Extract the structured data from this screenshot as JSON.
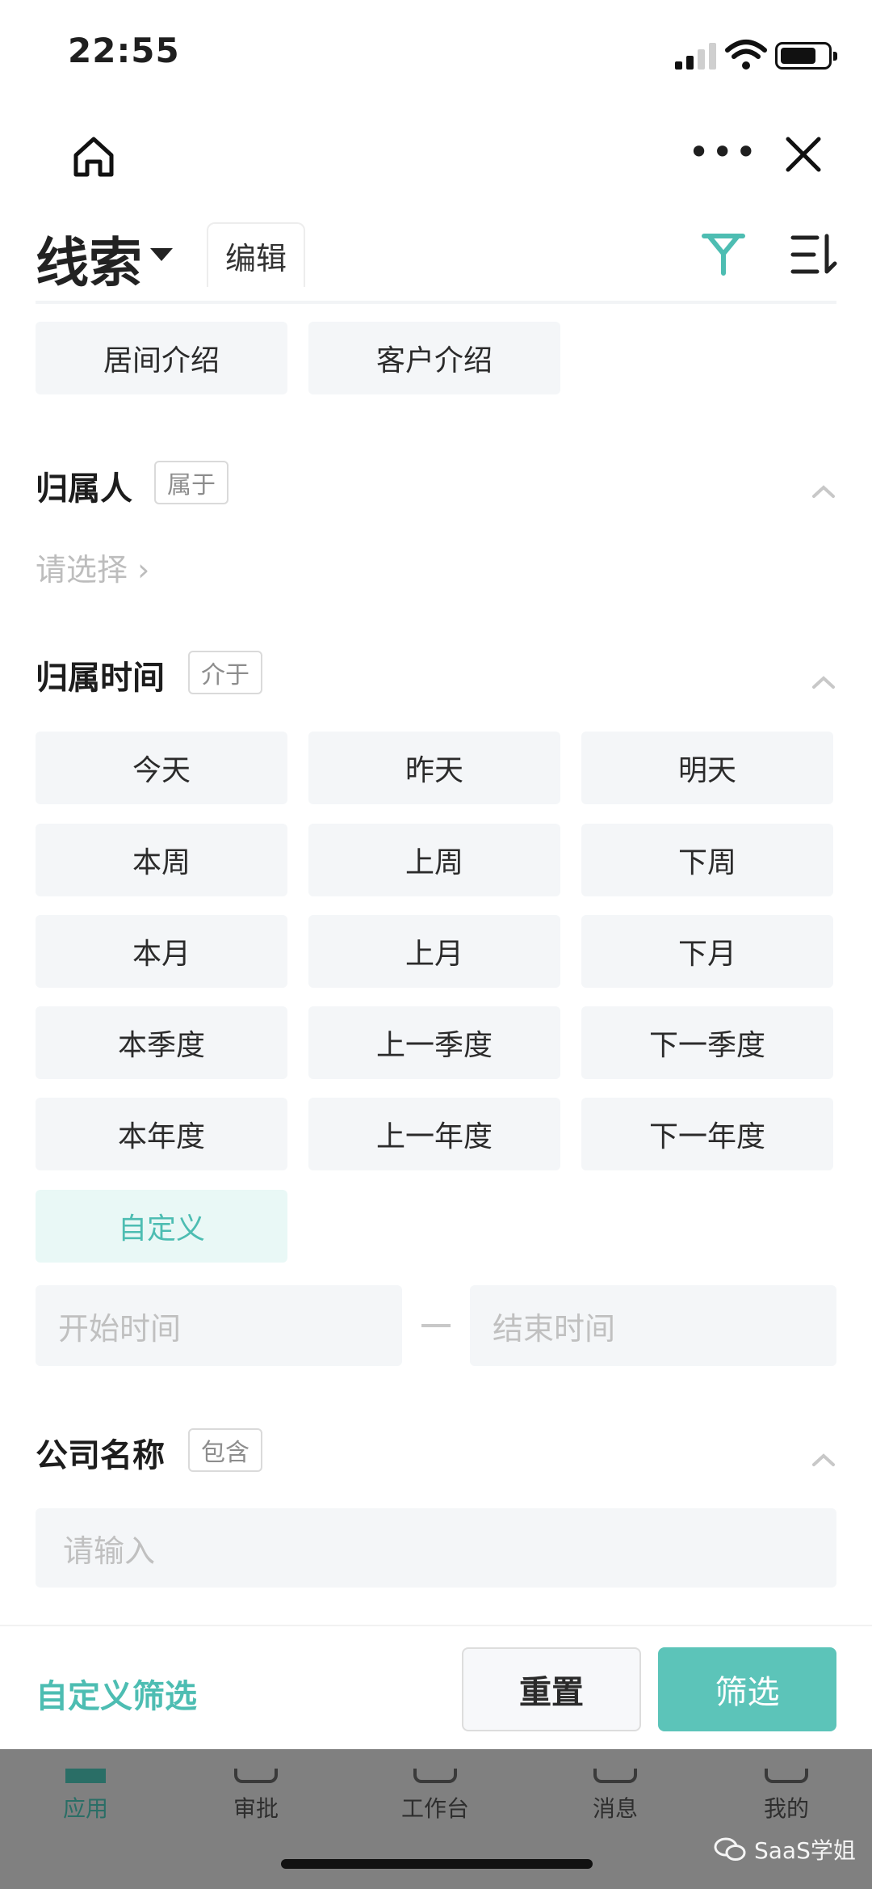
{
  "status_bar": {
    "time": "22:55"
  },
  "header": {
    "title": "线索",
    "edit_tab": "编辑"
  },
  "source_chips": [
    "居间介绍",
    "客户介绍"
  ],
  "owner_section": {
    "title": "归属人",
    "operator": "属于",
    "prompt": "请选择"
  },
  "time_section": {
    "title": "归属时间",
    "operator": "介于",
    "options": [
      "今天",
      "昨天",
      "明天",
      "本周",
      "上周",
      "下周",
      "本月",
      "上月",
      "下月",
      "本季度",
      "上一季度",
      "下一季度",
      "本年度",
      "上一年度",
      "下一年度",
      "自定义"
    ],
    "selected": "自定义",
    "start_placeholder": "开始时间",
    "end_placeholder": "结束时间"
  },
  "company_section": {
    "title": "公司名称",
    "operator": "包含",
    "placeholder": "请输入"
  },
  "footer": {
    "custom_filter": "自定义筛选",
    "reset": "重置",
    "submit": "筛选"
  },
  "tab_bar": {
    "items": [
      "应用",
      "审批",
      "工作台",
      "消息",
      "我的"
    ],
    "active": "应用"
  },
  "watermark": "SaaS学姐",
  "colors": {
    "accent": "#5cc4b9",
    "chip_bg": "#f4f6f8",
    "active_chip_bg": "#e9f8f6"
  },
  "icons": [
    "home-icon",
    "more-icon",
    "close-icon",
    "filter-icon",
    "list-icon",
    "chevron-up-icon",
    "wechat-icon"
  ]
}
